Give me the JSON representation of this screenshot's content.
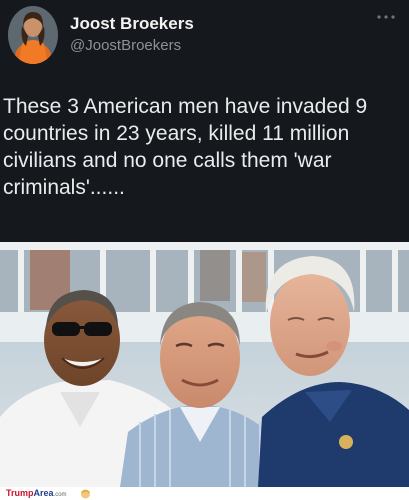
{
  "author": {
    "name": "Joost Broekers",
    "handle": "@JoostBroekers"
  },
  "header": {
    "more_icon": "ellipsis-icon",
    "more_label": "..."
  },
  "tweet": {
    "text": "These 3 American men have invaded 9 countries in 23 years, killed 11 million civilians and no one calls them 'war criminals'......"
  },
  "photo": {
    "description_icon": "photo-three-men"
  },
  "footer": {
    "brand_main": "Trump",
    "brand_sub": "Area",
    "brand_tld": ".com"
  },
  "colors": {
    "background": "#15181c",
    "text": "#e7e9ea",
    "handle": "#8b9299",
    "brand_red": "#c8102e",
    "brand_blue": "#1d3f8f"
  }
}
